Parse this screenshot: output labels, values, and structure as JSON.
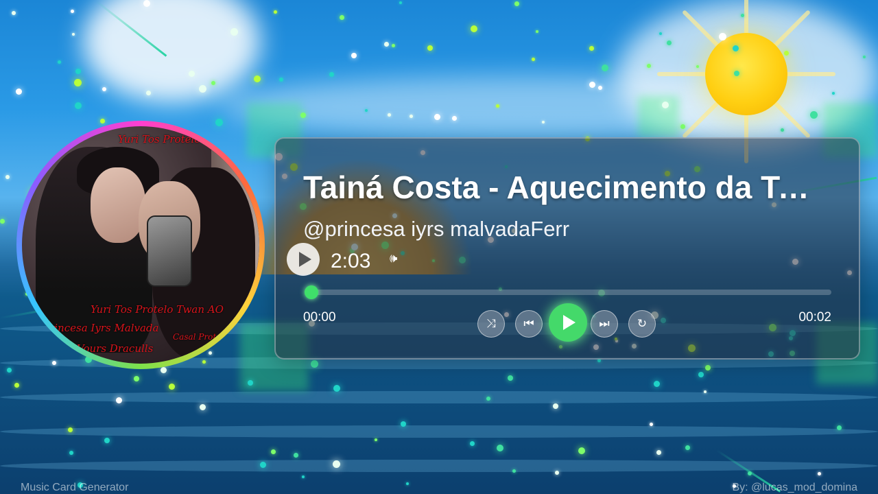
{
  "card": {
    "title": "Tainá Costa - Aquecimento da Tai...",
    "artist": "@princesa iyrs malvadaFerr",
    "current_time_display": "2:03",
    "progress": {
      "elapsed": "00:00",
      "total": "00:02",
      "fraction": 0.0
    },
    "controls": [
      "shuffle-icon",
      "previous-icon",
      "play-icon",
      "next-icon",
      "repeat-icon"
    ],
    "accent_color": "#44d96a"
  },
  "album_art": {
    "caption_lines": [
      "Yuri Tos Protelo",
      "Yuri Tos Protelo Twan AO",
      "Princesa Iyrs Malvada",
      "Casal Protelo",
      "Vours Draculls"
    ]
  },
  "footer": {
    "left": "Music Card Generator",
    "right": "By: @lucas_mod_domina"
  }
}
